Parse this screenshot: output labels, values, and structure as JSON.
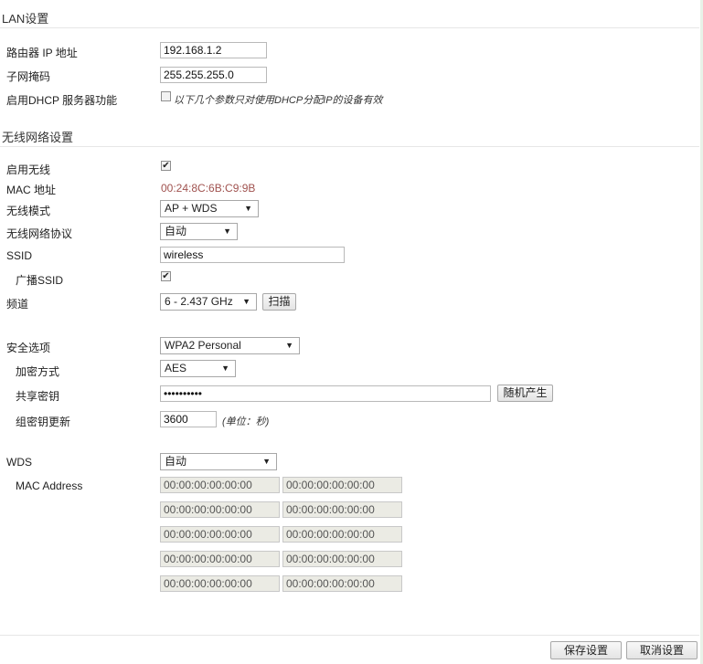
{
  "lan": {
    "title": "LAN设置",
    "ip_label": "路由器 IP 地址",
    "ip_value": "192.168.1.2",
    "mask_label": "子网掩码",
    "mask_value": "255.255.255.0",
    "dhcp_label": "启用DHCP 服务器功能",
    "dhcp_checked": false,
    "dhcp_hint": "以下几个参数只对使用DHCP分配IP的设备有效"
  },
  "wireless": {
    "title": "无线网络设置",
    "enable_label": "启用无线",
    "enable_checked": true,
    "mac_label": "MAC 地址",
    "mac_value": "00:24:8C:6B:C9:9B",
    "mode_label": "无线模式",
    "mode_value": "AP + WDS",
    "protocol_label": "无线网络协议",
    "protocol_value": "自动",
    "ssid_label": "SSID",
    "ssid_value": "wireless",
    "broadcast_label": "广播SSID",
    "broadcast_checked": true,
    "channel_label": "频道",
    "channel_value": "6 - 2.437 GHz",
    "scan_button": "扫描"
  },
  "security": {
    "option_label": "安全选项",
    "option_value": "WPA2 Personal",
    "encryption_label": "加密方式",
    "encryption_value": "AES",
    "key_label": "共享密钥",
    "key_value": "••••••••••",
    "random_button": "随机产生",
    "rekey_label": "组密钥更新",
    "rekey_value": "3600",
    "rekey_unit": "(单位：秒)"
  },
  "wds": {
    "label": "WDS",
    "value": "自动",
    "mac_address_label": "MAC Address",
    "mac_fields": [
      "00:00:00:00:00:00",
      "00:00:00:00:00:00",
      "00:00:00:00:00:00",
      "00:00:00:00:00:00",
      "00:00:00:00:00:00",
      "00:00:00:00:00:00",
      "00:00:00:00:00:00",
      "00:00:00:00:00:00",
      "00:00:00:00:00:00",
      "00:00:00:00:00:00"
    ]
  },
  "footer": {
    "save_button": "保存设置",
    "cancel_button": "取消设置"
  }
}
